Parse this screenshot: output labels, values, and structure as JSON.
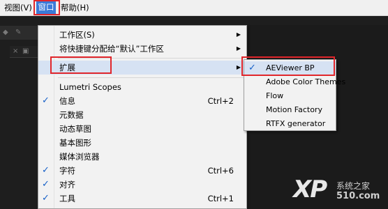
{
  "menubar": {
    "view_label": "视图(V)",
    "window_label": "窗口",
    "help_label": "帮助(H)"
  },
  "window_menu": {
    "items": [
      {
        "label": "工作区(S)",
        "checked": false,
        "shortcut": "",
        "submenu": true
      },
      {
        "label": "将快捷键分配给“默认”工作区",
        "checked": false,
        "shortcut": "",
        "submenu": true
      },
      {
        "label": "扩展",
        "checked": false,
        "shortcut": "",
        "submenu": true
      },
      {
        "label": "Lumetri Scopes",
        "checked": false,
        "shortcut": "",
        "submenu": false
      },
      {
        "label": "信息",
        "checked": true,
        "shortcut": "Ctrl+2",
        "submenu": false
      },
      {
        "label": "元数据",
        "checked": false,
        "shortcut": "",
        "submenu": false
      },
      {
        "label": "动态草图",
        "checked": false,
        "shortcut": "",
        "submenu": false
      },
      {
        "label": "基本图形",
        "checked": false,
        "shortcut": "",
        "submenu": false
      },
      {
        "label": "媒体浏览器",
        "checked": false,
        "shortcut": "",
        "submenu": false
      },
      {
        "label": "字符",
        "checked": true,
        "shortcut": "Ctrl+6",
        "submenu": false
      },
      {
        "label": "对齐",
        "checked": true,
        "shortcut": "",
        "submenu": false
      },
      {
        "label": "工具",
        "checked": true,
        "shortcut": "Ctrl+1",
        "submenu": false
      }
    ],
    "check_glyph": "✓",
    "arrow_glyph": "▶"
  },
  "extensions_submenu": {
    "items": [
      {
        "label": "AEViewer BP",
        "checked": true
      },
      {
        "label": "Adobe Color Themes",
        "checked": false
      },
      {
        "label": "Flow",
        "checked": false
      },
      {
        "label": "Motion Factory",
        "checked": false
      },
      {
        "label": "RTFX generator",
        "checked": false
      }
    ]
  },
  "watermark": {
    "logo": "XP",
    "site_cn": "系统之家",
    "site_num": "510.com"
  },
  "colors": {
    "highlight": "#3b7ad8",
    "annotation_red": "#e1262b",
    "check_blue": "#1660c8"
  }
}
